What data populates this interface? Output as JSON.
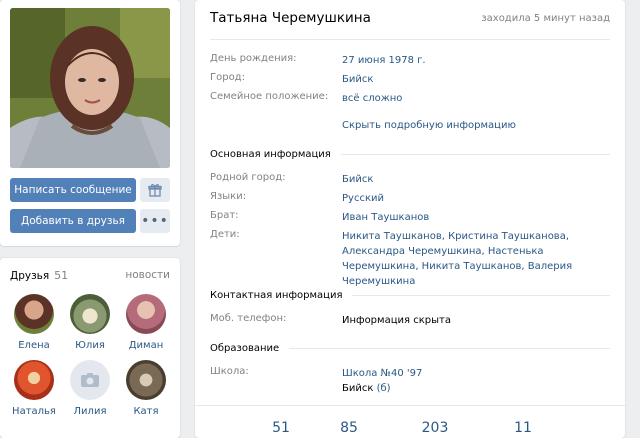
{
  "profile": {
    "name": "Татьяна Черемушкина",
    "online_status": "заходила 5 минут назад"
  },
  "actions": {
    "message_label": "Написать сообщение",
    "add_friend_label": "Добавить в друзья",
    "more_label": "•••",
    "gift_icon": "gift-icon"
  },
  "info": {
    "short": [
      {
        "key": "День рождения:",
        "value": "27 июня 1978 г."
      },
      {
        "key": "Город:",
        "value": "Бийск"
      },
      {
        "key": "Семейное положение:",
        "value": "всё сложно"
      }
    ],
    "hide_details_label": "Скрыть подробную информацию",
    "basic_title": "Основная информация",
    "basic": [
      {
        "key": "Родной город:",
        "value": "Бийск"
      },
      {
        "key": "Языки:",
        "value": "Русский"
      },
      {
        "key": "Брат:",
        "value": "Иван Таушканов"
      },
      {
        "key": "Дети:",
        "value": "Никита Таушканов, Кристина Таушканова, Александра Черемушкина, Настенька Черемушкина, Никита Таушканов, Валерия Черемушкина"
      }
    ],
    "contact_title": "Контактная информация",
    "contact": [
      {
        "key": "Моб. телефон:",
        "value": "Информация скрыта"
      }
    ],
    "education_title": "Образование",
    "education": [
      {
        "key": "Школа:",
        "value": "Школа №40 '97",
        "value2": "Бийск",
        "value2_suffix": "(б)"
      }
    ]
  },
  "friends": {
    "title": "Друзья",
    "count": "51",
    "news_label": "новости",
    "items": [
      {
        "name": "Елена",
        "color": "#6b4a3a"
      },
      {
        "name": "Юлия",
        "color": "#7d8a6a"
      },
      {
        "name": "Диман",
        "color": "#b56b7a"
      },
      {
        "name": "Наталья",
        "color": "#c0462e"
      },
      {
        "name": "Лилия",
        "color": "#e4e8ee"
      },
      {
        "name": "Катя",
        "color": "#7a6a55"
      }
    ]
  },
  "stats": [
    "51",
    "85",
    "203",
    "11"
  ]
}
